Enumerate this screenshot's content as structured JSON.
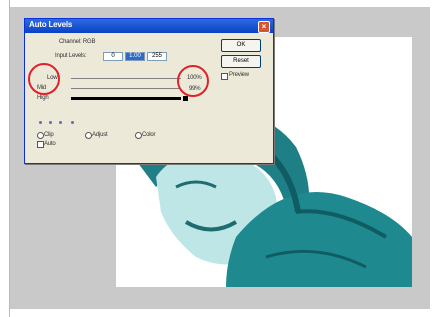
{
  "dialog": {
    "title": "Auto Levels",
    "close_glyph": "×",
    "channel_label": "Channel: RGB",
    "input_levels_label": "Input Levels:",
    "input_values": [
      "0",
      "1.00",
      "255"
    ],
    "left_labels": [
      "Low",
      "Mid",
      "High"
    ],
    "right_labels": [
      "100%",
      "99%"
    ],
    "buttons": [
      "OK",
      "Reset"
    ],
    "preview_label": "Preview",
    "options": [
      "Clip",
      "Adjust",
      "Color"
    ],
    "checkbox_label": "Auto"
  },
  "colors": {
    "titlebar": "#0842c4",
    "photo_tint": "#1e8a8f",
    "annotation": "#e0212b"
  }
}
